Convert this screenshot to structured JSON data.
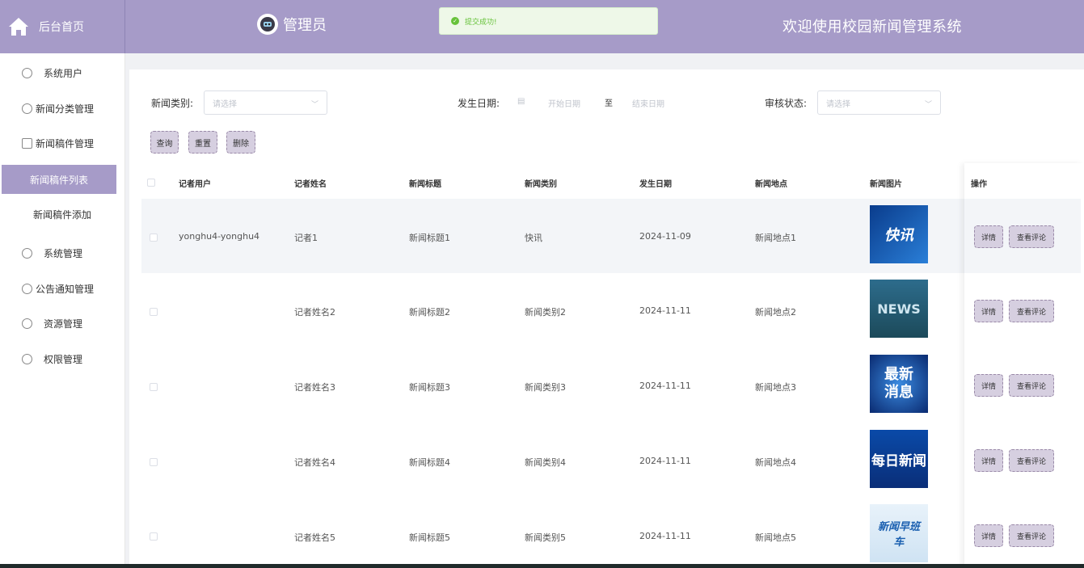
{
  "header": {
    "home_label": "后台首页",
    "admin_name": "管理员",
    "toast": "提交成功!",
    "welcome": "欢迎使用校园新闻管理系统"
  },
  "sidebar": {
    "items": [
      {
        "label": "系统用户"
      },
      {
        "label": "新闻分类管理"
      },
      {
        "label": "新闻稿件管理"
      },
      {
        "label": "新闻稿件列表"
      },
      {
        "label": "新闻稿件添加"
      },
      {
        "label": "系统管理"
      },
      {
        "label": "公告通知管理"
      },
      {
        "label": "资源管理"
      },
      {
        "label": "权限管理"
      }
    ]
  },
  "filters": {
    "category_label": "新闻类别:",
    "category_placeholder": "请选择",
    "date_label": "发生日期:",
    "date_start": "开始日期",
    "date_sep": "至",
    "date_end": "结束日期",
    "status_label": "审核状态:",
    "status_placeholder": "请选择"
  },
  "actions": {
    "query": "查询",
    "reset": "重置",
    "delete": "删除"
  },
  "table": {
    "headers": [
      "记者用户",
      "记者姓名",
      "新闻标题",
      "新闻类别",
      "发生日期",
      "新闻地点",
      "新闻图片",
      "操作"
    ],
    "rows": [
      {
        "user": "yonghu4-yonghu4",
        "name": "记者1",
        "title": "新闻标题1",
        "category": "快讯",
        "date": "2024-11-09",
        "place": "新闻地点1",
        "img": "快讯"
      },
      {
        "user": "",
        "name": "记者姓名2",
        "title": "新闻标题2",
        "category": "新闻类别2",
        "date": "2024-11-11",
        "place": "新闻地点2",
        "img": "NEWS"
      },
      {
        "user": "",
        "name": "记者姓名3",
        "title": "新闻标题3",
        "category": "新闻类别3",
        "date": "2024-11-11",
        "place": "新闻地点3",
        "img": "最新消息"
      },
      {
        "user": "",
        "name": "记者姓名4",
        "title": "新闻标题4",
        "category": "新闻类别4",
        "date": "2024-11-11",
        "place": "新闻地点4",
        "img": "每日新闻"
      },
      {
        "user": "",
        "name": "记者姓名5",
        "title": "新闻标题5",
        "category": "新闻类别5",
        "date": "2024-11-11",
        "place": "新闻地点5",
        "img": "新闻早班车"
      }
    ],
    "detail_label": "详情",
    "comment_label": "查看评论"
  },
  "colors": {
    "header_bg": "#a69bc8",
    "button_bg": "#d6cfe0",
    "toast_green": "#67c23a"
  }
}
